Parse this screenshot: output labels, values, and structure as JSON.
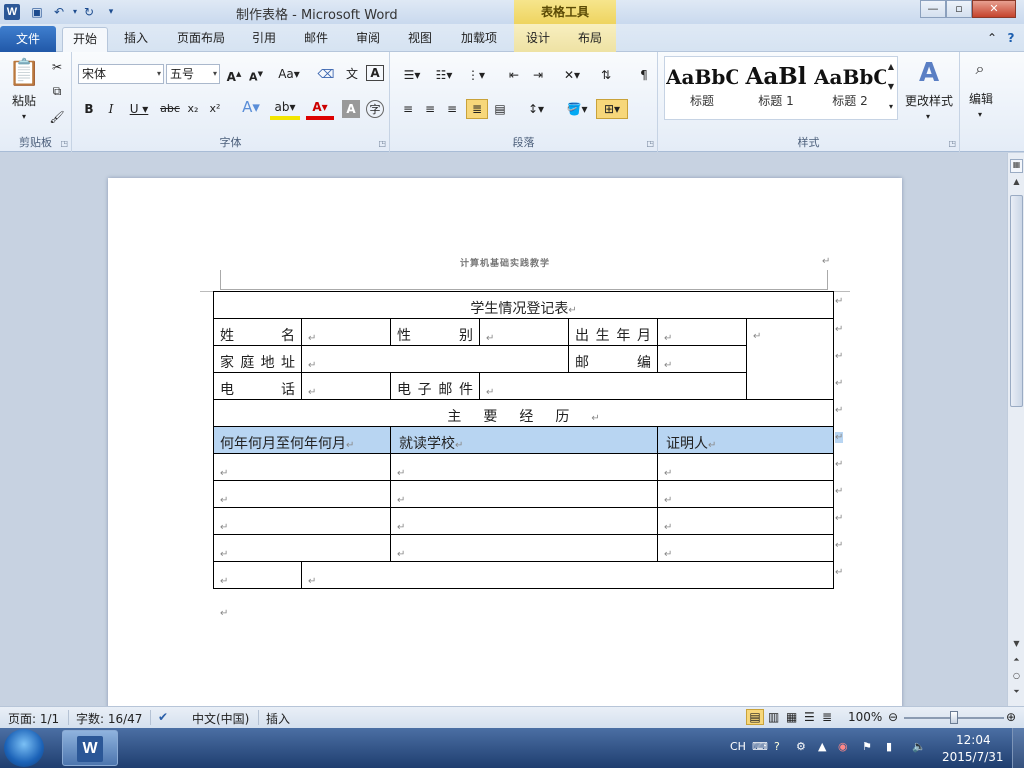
{
  "window": {
    "title": "制作表格 - Microsoft Word",
    "context_tools": "表格工具",
    "min": "—",
    "max": "▫",
    "close": "✕"
  },
  "tabs": {
    "file": "文件",
    "home": "开始",
    "insert": "插入",
    "layout": "页面布局",
    "references": "引用",
    "mailings": "邮件",
    "review": "审阅",
    "view": "视图",
    "addins": "加载项",
    "design": "设计",
    "table_layout": "布局"
  },
  "ribbon": {
    "clipboard_label": "剪贴板",
    "paste": "粘贴",
    "font_label": "字体",
    "font_name": "宋体",
    "font_size": "五号",
    "paragraph_label": "段落",
    "styles_label": "样式",
    "styles": [
      {
        "sample": "AaBbC",
        "name": "标题"
      },
      {
        "sample": "AaBl",
        "name": "标题 1"
      },
      {
        "sample": "AaBbC",
        "name": "标题 2"
      }
    ],
    "change_styles": "更改样式",
    "editing": "编辑"
  },
  "document": {
    "header": "计算机基础实践教学",
    "table_title": "学生情况登记表",
    "name_label": "姓名",
    "gender_label": "性别",
    "birth_label": "出生年月",
    "address_label": "家庭地址",
    "zip_label": "邮编",
    "phone_label": "电话",
    "email_label": "电子邮件",
    "history_label": "主要经历",
    "col_period": "何年何月至何年何月",
    "col_school": "就读学校",
    "col_witness": "证明人"
  },
  "status": {
    "page": "页面: 1/1",
    "words": "字数: 16/47",
    "language": "中文(中国)",
    "mode": "插入",
    "zoom": "100%"
  },
  "tray": {
    "ime": "CH",
    "time": "12:04",
    "date": "2015/7/31"
  }
}
